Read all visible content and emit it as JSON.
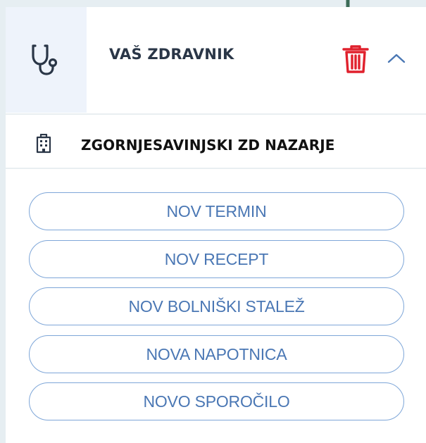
{
  "header": {
    "title": "VAŠ ZDRAVNIK",
    "icon": "stethoscope-icon",
    "delete_icon": "trash-icon",
    "collapse_icon": "chevron-up-icon"
  },
  "facility": {
    "icon": "building-icon",
    "name": "ZGORNJESAVINJSKI ZD NAZARJE"
  },
  "actions": [
    {
      "label": "NOV TERMIN"
    },
    {
      "label": "NOV RECEPT"
    },
    {
      "label": "NOV BOLNIŠKI STALEŽ"
    },
    {
      "label": "NOVA NAPOTNICA"
    },
    {
      "label": "NOVO SPOROČILO"
    }
  ],
  "colors": {
    "accent_blue": "#4a77b4",
    "button_border": "#7ea6d8",
    "delete_red": "#e0212d",
    "icon_tile_bg": "#eef3fb",
    "pin_green": "#3b6b57"
  }
}
